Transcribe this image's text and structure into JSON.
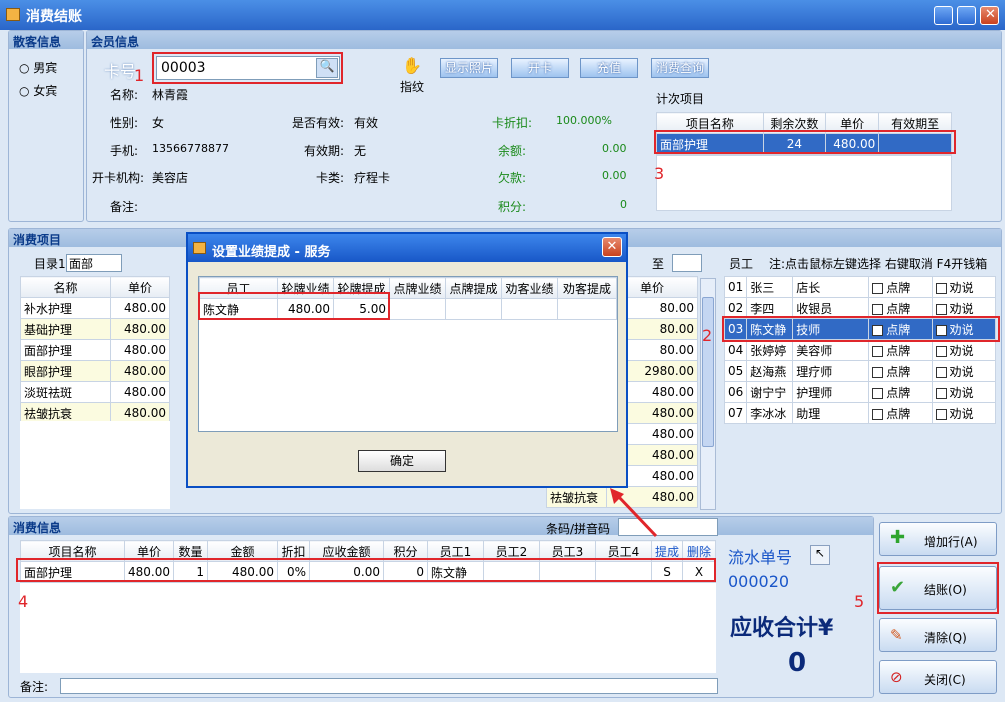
{
  "window": {
    "title": "消费结账"
  },
  "guest": {
    "title": "散客信息",
    "options": [
      "男宾",
      "女宾"
    ]
  },
  "member": {
    "title": "会员信息",
    "card_label": "卡号",
    "card_no": "00003",
    "fingerprint": "指纹",
    "buttons": [
      "显示照片",
      "开卡",
      "充值",
      "消费查询"
    ],
    "name_label": "名称:",
    "name": "林青霞",
    "gender_label": "性别:",
    "gender": "女",
    "phone_label": "手机:",
    "phone": "13566778877",
    "org_label": "开卡机构:",
    "org": "美容店",
    "note_label": "备注:",
    "valid_label": "是否有效:",
    "valid": "有效",
    "expire_label": "有效期:",
    "expire": "无",
    "type_label": "卡类:",
    "type": "疗程卡",
    "discount_label": "卡折扣:",
    "discount": "100.000%",
    "balance_label": "余额:",
    "balance": "0.00",
    "debt_label": "欠款:",
    "debt": "0.00",
    "points_label": "积分:",
    "points": "0",
    "count_title": "计次项目",
    "count_headers": [
      "项目名称",
      "剩余次数",
      "单价",
      "有效期至"
    ],
    "count_rows": [
      {
        "name": "面部护理",
        "remain": "24",
        "price": "480.00",
        "expire": ""
      }
    ]
  },
  "consume": {
    "title": "消费项目",
    "dir_label": "目录1",
    "dir_value": "面部",
    "to_label": "至",
    "headers": [
      "名称",
      "单价"
    ],
    "items": [
      {
        "name": "补水护理",
        "price": "480.00"
      },
      {
        "name": "基础护理",
        "price": "480.00"
      },
      {
        "name": "面部护理",
        "price": "480.00"
      },
      {
        "name": "眼部护理",
        "price": "480.00"
      },
      {
        "name": "淡斑祛斑",
        "price": "480.00"
      },
      {
        "name": "祛皱抗衰",
        "price": "480.00"
      }
    ],
    "mid_header": "单价",
    "mid_prices": [
      "80.00",
      "80.00",
      "80.00",
      "2980.00",
      "480.00",
      "480.00",
      "480.00",
      "480.00",
      "480.00",
      "480.00"
    ],
    "mid_last_name": "祛皱抗衰"
  },
  "staff": {
    "title": "员工",
    "hint": "注:点击鼠标左键选择 右键取消 F4开钱箱",
    "dian": "点牌",
    "quan": "劝说",
    "rows": [
      {
        "no": "01",
        "name": "张三",
        "role": "店长"
      },
      {
        "no": "02",
        "name": "李四",
        "role": "收银员"
      },
      {
        "no": "03",
        "name": "陈文静",
        "role": "技师"
      },
      {
        "no": "04",
        "name": "张婷婷",
        "role": "美容师"
      },
      {
        "no": "05",
        "name": "赵海燕",
        "role": "理疗师"
      },
      {
        "no": "06",
        "name": "谢宁宁",
        "role": "护理师"
      },
      {
        "no": "07",
        "name": "李冰冰",
        "role": "助理"
      }
    ]
  },
  "dialog": {
    "title": "设置业绩提成 - 服务",
    "headers": [
      "员工",
      "轮牌业绩",
      "轮牌提成",
      "点牌业绩",
      "点牌提成",
      "劝客业绩",
      "劝客提成"
    ],
    "row": {
      "staff": "陈文静",
      "perf": "480.00",
      "comm": "5.00"
    },
    "ok": "确定"
  },
  "bill": {
    "title": "消费信息",
    "barcode_label": "条码/拼音码",
    "headers": [
      "项目名称",
      "单价",
      "数量",
      "金额",
      "折扣",
      "应收金额",
      "积分",
      "员工1",
      "员工2",
      "员工3",
      "员工4",
      "提成",
      "删除"
    ],
    "row": {
      "name": "面部护理",
      "price": "480.00",
      "qty": "1",
      "amount": "480.00",
      "disc": "0%",
      "due": "0.00",
      "points": "0",
      "staff1": "陈文静",
      "comm": "S",
      "del": "X"
    },
    "note_label": "备注:"
  },
  "summary": {
    "serial_label": "流水单号",
    "serial": "000020",
    "total_label": "应收合计¥",
    "total": "0"
  },
  "actions": {
    "add": "增加行(A)",
    "checkout": "结账(O)",
    "clear": "清除(Q)",
    "close": "关闭(C)"
  },
  "markers": [
    "1",
    "2",
    "3",
    "4",
    "5"
  ]
}
